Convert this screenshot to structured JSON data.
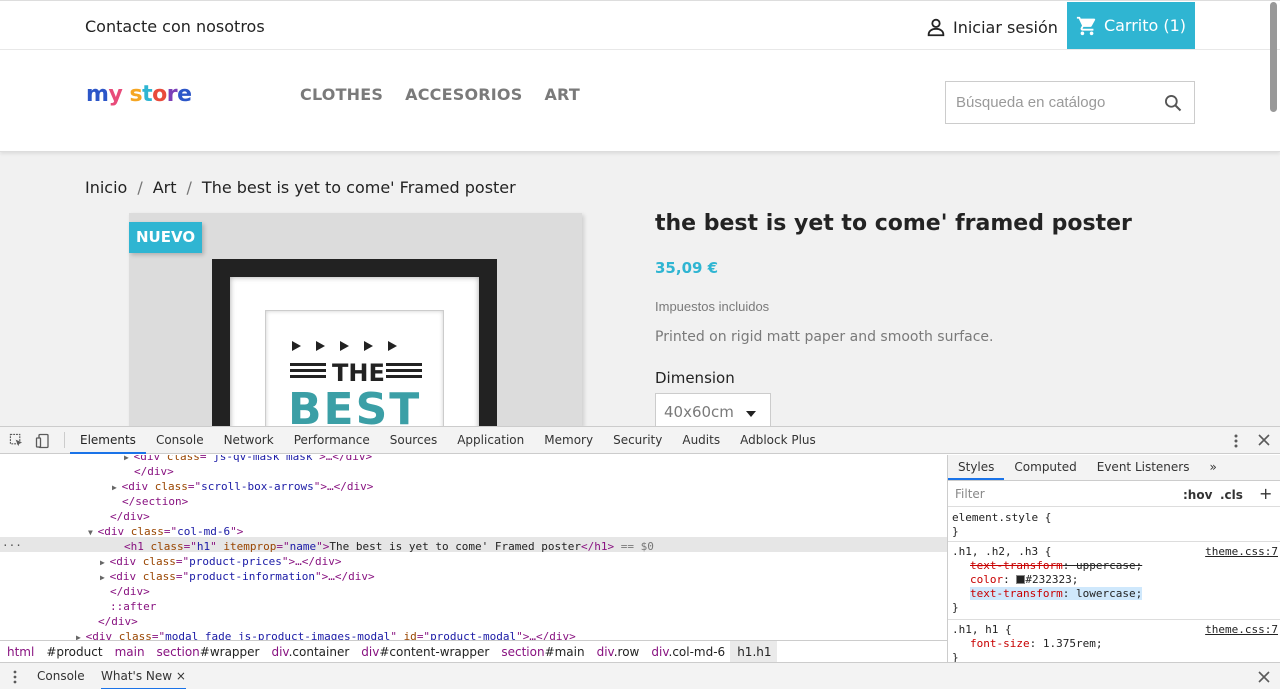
{
  "site": {
    "topbar": {
      "contact": "Contacte con nosotros",
      "login": "Iniciar sesión",
      "cart": "Carrito (1)"
    },
    "logo": {
      "text": "my store"
    },
    "nav": [
      "CLOTHES",
      "ACCESORIOS",
      "ART"
    ],
    "search": {
      "placeholder": "Búsqueda en catálogo"
    },
    "breadcrumb": [
      "Inicio",
      "Art",
      "The best is yet to come' Framed poster"
    ],
    "breadcrumb_separator": "/",
    "product": {
      "badge": "NUEVO",
      "title": "The best is yet to come' Framed poster",
      "price": "35,09 €",
      "taxes": "Impuestos incluidos",
      "description": "Printed on rigid matt paper and smooth surface.",
      "dimension_label": "Dimension",
      "dimension_value": "40x60cm",
      "poster": {
        "the": "THE",
        "best": "BEST"
      }
    },
    "colors": {
      "accent": "#2fb5d2",
      "text": "#232323",
      "muted": "#7a7a7a"
    }
  },
  "devtools": {
    "tabs": [
      "Elements",
      "Console",
      "Network",
      "Performance",
      "Sources",
      "Application",
      "Memory",
      "Security",
      "Audits",
      "Adblock Plus"
    ],
    "active_tab": "Elements",
    "dom_lines": [
      {
        "indent": 136,
        "tri": "▶",
        "tag": "div",
        "attrs": [
          [
            "class",
            "js-qv-mask mask"
          ]
        ],
        "tail": ">…</div>"
      },
      {
        "indent": 134,
        "close": "</div>"
      },
      {
        "indent": 124,
        "tri": "▶",
        "tag": "div",
        "attrs": [
          [
            "class",
            "scroll-box-arrows"
          ]
        ],
        "tail": ">…</div>"
      },
      {
        "indent": 122,
        "close": "</section>"
      },
      {
        "indent": 110,
        "close": "</div>"
      },
      {
        "indent": 100,
        "tri": "▼",
        "tag": "div",
        "attrs": [
          [
            "class",
            "col-md-6"
          ]
        ],
        "tail": ">"
      },
      {
        "indent": 124,
        "tag": "h1",
        "attrs": [
          [
            "class",
            "h1"
          ],
          [
            "itemprop",
            "name"
          ]
        ],
        "text": "The best is yet to come' Framed poster",
        "tail": "</h1>",
        "marker": " == $0",
        "selected": true
      },
      {
        "indent": 112,
        "tri": "▶",
        "tag": "div",
        "attrs": [
          [
            "class",
            "product-prices"
          ]
        ],
        "tail": ">…</div>"
      },
      {
        "indent": 112,
        "tri": "▶",
        "tag": "div",
        "attrs": [
          [
            "class",
            "product-information"
          ]
        ],
        "tail": ">…</div>"
      },
      {
        "indent": 110,
        "close": "</div>"
      },
      {
        "indent": 110,
        "pseudo": "::after"
      },
      {
        "indent": 98,
        "close": "</div>"
      },
      {
        "indent": 88,
        "tri": "▶",
        "tag": "div",
        "attrs": [
          [
            "class",
            "modal fade js-product-images-modal"
          ],
          [
            "id",
            "product-modal"
          ]
        ],
        "tail": ">…</div>"
      }
    ],
    "dom_dots": "...",
    "breadcrumbs": [
      {
        "tag": "html",
        "id": ""
      },
      {
        "tag": "",
        "id": "#product"
      },
      {
        "tag": "main",
        "id": ""
      },
      {
        "tag": "section",
        "id": "#wrapper"
      },
      {
        "tag": "div",
        "id": ".container"
      },
      {
        "tag": "div",
        "id": "#content-wrapper"
      },
      {
        "tag": "section",
        "id": "#main"
      },
      {
        "tag": "div",
        "id": ".row"
      },
      {
        "tag": "div",
        "id": ".col-md-6"
      },
      {
        "tag": "h1",
        "id": ".h1",
        "active": true
      }
    ],
    "styles": {
      "tabs": [
        "Styles",
        "Computed",
        "Event Listeners",
        "»"
      ],
      "filter_placeholder": "Filter",
      "hov": ":hov",
      "cls": ".cls",
      "plus": "+",
      "element_style": "element.style {",
      "close_brace": "}",
      "rule1": {
        "selector": ".h1, .h2, .h3 {",
        "source": "theme.css:7",
        "props": [
          {
            "name": "text-transform",
            "value": "uppercase;",
            "struck": true
          },
          {
            "name": "color",
            "value": "#232323;",
            "swatch": "#232323"
          },
          {
            "name": "text-transform",
            "value": "lowercase;",
            "highlight": true
          }
        ]
      },
      "rule2": {
        "selector": ".h1, h1 {",
        "source": "theme.css:7",
        "props": [
          {
            "name": "font-size",
            "value": "1.375rem;"
          }
        ]
      }
    },
    "drawer": {
      "console": "Console",
      "whats_new": "What's New",
      "close": "×"
    }
  }
}
